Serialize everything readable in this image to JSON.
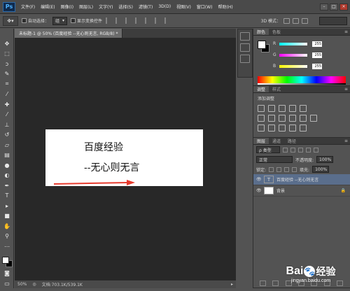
{
  "app": {
    "logo_text": "Ps"
  },
  "menu": {
    "items": [
      "文件(F)",
      "编辑(E)",
      "图像(I)",
      "图层(L)",
      "文字(Y)",
      "选择(S)",
      "滤镜(T)",
      "3D(D)",
      "视图(V)",
      "窗口(W)",
      "帮助(H)"
    ]
  },
  "options_bar": {
    "tool_icon": "move-tool-icon",
    "auto_select_label": "自动选择：",
    "auto_select_value": "组",
    "transform_controls_label": "显示变换控件",
    "mode_3d_label": "3D 模式："
  },
  "document": {
    "tab_title": "未标题-1 @ 50% (百度经验 --无心则无言, RGB/8) *",
    "canvas_line1": "百度经验",
    "canvas_line2": "--无心则无言",
    "arrow_color": "#e63b2e"
  },
  "status": {
    "zoom": "50%",
    "doc_size": "文档:703.1K/539.1K"
  },
  "color_panel": {
    "tabs": [
      "颜色",
      "色板"
    ],
    "channels": [
      {
        "label": "R",
        "value": "255",
        "gradient": "linear-gradient(90deg,#00ffff,#ffffff)"
      },
      {
        "label": "G",
        "value": "255",
        "gradient": "linear-gradient(90deg,#ff00ff,#ffffff)"
      },
      {
        "label": "B",
        "value": "255",
        "gradient": "linear-gradient(90deg,#ffff00,#ffffff)"
      }
    ]
  },
  "adjust_panel": {
    "tabs": [
      "调整",
      "样式"
    ],
    "subtitle": "添加调整"
  },
  "layers_panel": {
    "tabs": [
      "图层",
      "通道",
      "路径"
    ],
    "filter_label": "ρ 类型",
    "blend_mode": "正常",
    "opacity_label": "不透明度:",
    "opacity_value": "100%",
    "lock_label": "锁定:",
    "fill_label": "填充:",
    "fill_value": "100%",
    "layers": [
      {
        "name": "百度经验 --无心则无言",
        "type": "text",
        "selected": true
      },
      {
        "name": "背景",
        "type": "background",
        "selected": false
      }
    ]
  },
  "watermark": {
    "brand": "Bai",
    "brand_suffix": "经验",
    "url": "jingyan.baidu.com"
  }
}
